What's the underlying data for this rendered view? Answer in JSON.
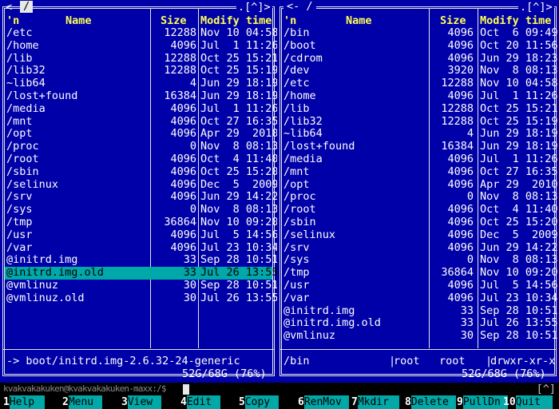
{
  "left": {
    "title": "/",
    "corner": ".[^]>",
    "headers": {
      "name": "Name",
      "name_prefix": "'n",
      "size": "Size",
      "time": "Modify time"
    },
    "rows": [
      {
        "name": "/etc",
        "size": "12288",
        "time": "Nov 10 04:58"
      },
      {
        "name": "/home",
        "size": "4096",
        "time": "Jul  1 11:26"
      },
      {
        "name": "/lib",
        "size": "12288",
        "time": "Oct 25 15:21"
      },
      {
        "name": "/lib32",
        "size": "12288",
        "time": "Oct 25 15:19"
      },
      {
        "name": "~lib64",
        "size": "4",
        "time": "Jun 29 18:19"
      },
      {
        "name": "/lost+found",
        "size": "16384",
        "time": "Jun 29 18:19"
      },
      {
        "name": "/media",
        "size": "4096",
        "time": "Jul  1 11:26"
      },
      {
        "name": "/mnt",
        "size": "4096",
        "time": "Oct 27 16:35"
      },
      {
        "name": "/opt",
        "size": "4096",
        "time": "Apr 29  2010"
      },
      {
        "name": "/proc",
        "size": "0",
        "time": "Nov  8 08:13"
      },
      {
        "name": "/root",
        "size": "4096",
        "time": "Oct  4 11:40"
      },
      {
        "name": "/sbin",
        "size": "4096",
        "time": "Oct 25 15:20"
      },
      {
        "name": "/selinux",
        "size": "4096",
        "time": "Dec  5  2009"
      },
      {
        "name": "/srv",
        "size": "4096",
        "time": "Jun 29 14:22"
      },
      {
        "name": "/sys",
        "size": "0",
        "time": "Nov  8 08:13"
      },
      {
        "name": "/tmp",
        "size": "36864",
        "time": "Nov 10 09:20"
      },
      {
        "name": "/usr",
        "size": "4096",
        "time": "Jul  5 14:56"
      },
      {
        "name": "/var",
        "size": "4096",
        "time": "Jul 23 10:34"
      },
      {
        "name": "@initrd.img",
        "size": "33",
        "time": "Sep 28 10:51"
      },
      {
        "name": "@initrd.img.old",
        "size": "33",
        "time": "Jul 26 13:55"
      },
      {
        "name": "@vmlinuz",
        "size": "30",
        "time": "Sep 28 10:51"
      },
      {
        "name": "@vmlinuz.old",
        "size": "30",
        "time": "Jul 26 13:55"
      }
    ],
    "status": "-> boot/initrd.img-2.6.32-24-generic",
    "free": "52G/68G (76%)"
  },
  "right": {
    "title": "<- /",
    "corner": ".[^]>",
    "headers": {
      "name": "Name",
      "name_prefix": "'n",
      "size": "Size",
      "time": "Modify time"
    },
    "rows": [
      {
        "name": "/bin",
        "size": "4096",
        "time": "Oct  6 09:49"
      },
      {
        "name": "/boot",
        "size": "4096",
        "time": "Oct 20 11:56"
      },
      {
        "name": "/cdrom",
        "size": "4096",
        "time": "Jun 29 18:23"
      },
      {
        "name": "/dev",
        "size": "3920",
        "time": "Nov  8 08:13"
      },
      {
        "name": "/etc",
        "size": "12288",
        "time": "Nov 10 04:58"
      },
      {
        "name": "/home",
        "size": "4096",
        "time": "Jul  1 11:26"
      },
      {
        "name": "/lib",
        "size": "12288",
        "time": "Oct 25 15:21"
      },
      {
        "name": "/lib32",
        "size": "12288",
        "time": "Oct 25 15:19"
      },
      {
        "name": "~lib64",
        "size": "4",
        "time": "Jun 29 18:19"
      },
      {
        "name": "/lost+found",
        "size": "16384",
        "time": "Jun 29 18:19"
      },
      {
        "name": "/media",
        "size": "4096",
        "time": "Jul  1 11:26"
      },
      {
        "name": "/mnt",
        "size": "4096",
        "time": "Oct 27 16:35"
      },
      {
        "name": "/opt",
        "size": "4096",
        "time": "Apr 29  2010"
      },
      {
        "name": "/proc",
        "size": "0",
        "time": "Nov  8 08:13"
      },
      {
        "name": "/root",
        "size": "4096",
        "time": "Oct  4 11:40"
      },
      {
        "name": "/sbin",
        "size": "4096",
        "time": "Oct 25 15:20"
      },
      {
        "name": "/selinux",
        "size": "4096",
        "time": "Dec  5  2009"
      },
      {
        "name": "/srv",
        "size": "4096",
        "time": "Jun 29 14:22"
      },
      {
        "name": "/sys",
        "size": "0",
        "time": "Nov  8 08:13"
      },
      {
        "name": "/tmp",
        "size": "36864",
        "time": "Nov 10 09:20"
      },
      {
        "name": "/usr",
        "size": "4096",
        "time": "Jul  5 14:56"
      },
      {
        "name": "/var",
        "size": "4096",
        "time": "Jul 23 10:34"
      },
      {
        "name": "@initrd.img",
        "size": "33",
        "time": "Sep 28 10:51"
      },
      {
        "name": "@initrd.img.old",
        "size": "33",
        "time": "Jul 26 13:55"
      },
      {
        "name": "@vmlinuz",
        "size": "30",
        "time": "Sep 28 10:51"
      }
    ],
    "status": {
      "name": "/bin",
      "owner": "root",
      "group": "root",
      "perms": "drwxr-xr-x"
    },
    "free": "52G/68G (76%)"
  },
  "selected_left_index": 19,
  "cmdline": {
    "prompt": "kvakvakakuken@kvakvakakuken-maxx:/$",
    "corner": "[^]"
  },
  "fkeys": [
    {
      "num": "1",
      "label": "Help"
    },
    {
      "num": "2",
      "label": "Menu"
    },
    {
      "num": "3",
      "label": "View"
    },
    {
      "num": "4",
      "label": "Edit"
    },
    {
      "num": "5",
      "label": "Copy"
    },
    {
      "num": "6",
      "label": "RenMov"
    },
    {
      "num": "7",
      "label": "Mkdir"
    },
    {
      "num": "8",
      "label": "Delete"
    },
    {
      "num": "9",
      "label": "PullDn"
    },
    {
      "num": "10",
      "label": "Quit"
    }
  ],
  "colors": {
    "panel_bg": "#0000a8",
    "selection": "#00a8a8",
    "header": "#ffff55",
    "fkey_bg": "#00a8a8"
  }
}
